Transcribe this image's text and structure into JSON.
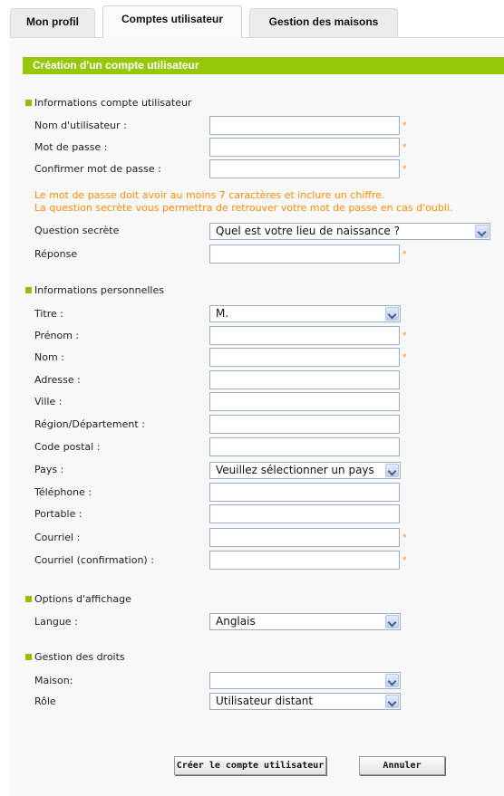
{
  "tabs": [
    {
      "label": "Mon profil",
      "active": false
    },
    {
      "label": "Comptes utilisateur",
      "active": true
    },
    {
      "label": "Gestion des maisons",
      "active": false
    }
  ],
  "panel": {
    "title": "Création d'un compte utilisateur"
  },
  "sections": {
    "account": "Informations compte utilisateur",
    "personal": "Informations personnelles",
    "display": "Options d'affichage",
    "rights": "Gestion des droits"
  },
  "account": {
    "username_label": "Nom d'utilisateur :",
    "password_label": "Mot de passe :",
    "confirm_password_label": "Confirmer mot de passe :",
    "notice_line1": "Le mot de passe doit avoir au moins 7 caractères et inclure un chiffre.",
    "notice_line2": "La question secrète vous permettra de retrouver votre mot de passe en cas d'oubli.",
    "secret_question_label": "Question secrète",
    "secret_question_value": "Quel est votre lieu de naissance ?",
    "answer_label": "Réponse"
  },
  "personal": {
    "title_label": "Titre :",
    "title_value": "M.",
    "firstname_label": "Prénom :",
    "lastname_label": "Nom :",
    "address_label": "Adresse :",
    "city_label": "Ville :",
    "region_label": "Région/Département :",
    "postal_label": "Code postal :",
    "country_label": "Pays :",
    "country_value": "Veuillez sélectionner un pays",
    "phone_label": "Téléphone :",
    "mobile_label": "Portable :",
    "email_label": "Courriel :",
    "email_confirm_label": "Courriel (confirmation) :"
  },
  "display": {
    "language_label": "Langue :",
    "language_value": "Anglais"
  },
  "rights": {
    "house_label": "Maison:",
    "house_value": "",
    "role_label": "Rôle",
    "role_value": "Utilisateur distant"
  },
  "required_mark": "*",
  "buttons": {
    "create": "Créer le compte utilisateur",
    "cancel": "Annuler"
  },
  "colors": {
    "accent_green": "#96c80a",
    "required_orange": "#ff8800",
    "notice_orange": "#ff8a00"
  }
}
